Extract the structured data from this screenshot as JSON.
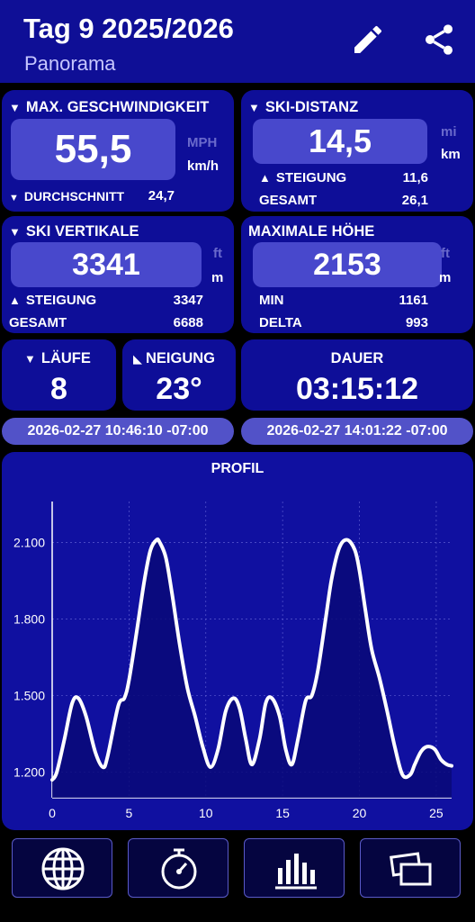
{
  "header": {
    "title": "Tag 9 2025/2026",
    "subtitle": "Panorama",
    "edit_icon": "pencil-icon",
    "share_icon": "share-icon"
  },
  "max_speed": {
    "label": "MAX. GESCHWINDIGKEIT",
    "value": "55,5",
    "unit_alt": "MPH",
    "unit": "km/h",
    "avg_label": "DURCHSCHNITT",
    "avg_value": "24,7"
  },
  "ski_distance": {
    "label": "SKI-DISTANZ",
    "value": "14,5",
    "unit_alt": "mi",
    "unit": "km",
    "climb_label": "STEIGUNG",
    "climb_value": "11,6",
    "total_label": "GESAMT",
    "total_value": "26,1"
  },
  "ski_vertical": {
    "label": "SKI VERTIKALE",
    "value": "3341",
    "unit_alt": "ft",
    "unit": "m",
    "climb_label": "STEIGUNG",
    "climb_value": "3347",
    "total_label": "GESAMT",
    "total_value": "6688"
  },
  "max_altitude": {
    "label": "MAXIMALE HÖHE",
    "value": "2153",
    "unit_alt": "ft",
    "unit": "m",
    "min_label": "MIN",
    "min_value": "1161",
    "delta_label": "DELTA",
    "delta_value": "993"
  },
  "runs": {
    "label": "LÄUFE",
    "value": "8"
  },
  "slope": {
    "label": "NEIGUNG",
    "value": "23°"
  },
  "duration": {
    "label": "DAUER",
    "value": "03:15:12"
  },
  "times": {
    "start": "2026-02-27 10:46:10 -07:00",
    "end": "2026-02-27 14:01:22 -07:00"
  },
  "colors": {
    "card": "#0e0e98",
    "value_box": "#4848cc",
    "pill": "#5252c8",
    "chart_bg": "#1010a0"
  },
  "nav": [
    {
      "icon": "globe-icon"
    },
    {
      "icon": "stopwatch-icon"
    },
    {
      "icon": "bar-chart-icon"
    },
    {
      "icon": "overlapping-windows-icon"
    }
  ],
  "chart_data": {
    "type": "area",
    "title": "PROFIL",
    "xlabel": "",
    "ylabel": "",
    "xlim": [
      0,
      26
    ],
    "ylim": [
      1100,
      2260
    ],
    "x_ticks": [
      0,
      5,
      10,
      15,
      20,
      25
    ],
    "x_tick_labels": [
      "0",
      "5",
      "10",
      "15",
      "20",
      "25"
    ],
    "y_ticks": [
      1200,
      1500,
      1800,
      2100
    ],
    "y_tick_labels": [
      "1.200",
      "1.500",
      "1.800",
      "2.100"
    ],
    "grid": true,
    "series": [
      {
        "x": [
          0,
          0.3,
          0.8,
          1.3,
          1.7,
          2.2,
          2.8,
          3.3,
          3.6,
          4.3,
          4.7,
          5.0,
          5.5,
          6.0,
          6.4,
          6.8,
          7.0,
          7.4,
          7.8,
          8.3,
          8.8,
          9.3,
          9.8,
          10.3,
          10.8,
          11.3,
          11.8,
          12.2,
          12.6,
          13.0,
          13.5,
          13.9,
          14.3,
          14.8,
          15.2,
          15.6,
          16.0,
          16.5,
          16.9,
          17.3,
          17.8,
          18.2,
          18.7,
          19.2,
          19.7,
          20.0,
          20.4,
          20.8,
          21.3,
          21.8,
          22.3,
          22.8,
          23.3,
          23.6,
          24.0,
          24.4,
          24.9,
          25.3,
          25.7,
          26.0
        ],
        "values": [
          1170,
          1200,
          1330,
          1470,
          1490,
          1420,
          1280,
          1220,
          1260,
          1460,
          1490,
          1560,
          1750,
          1950,
          2070,
          2110,
          2100,
          2040,
          1900,
          1700,
          1530,
          1420,
          1300,
          1220,
          1290,
          1440,
          1490,
          1450,
          1330,
          1230,
          1330,
          1470,
          1490,
          1420,
          1290,
          1230,
          1330,
          1480,
          1500,
          1600,
          1800,
          1960,
          2080,
          2110,
          2070,
          1990,
          1830,
          1680,
          1570,
          1440,
          1300,
          1190,
          1190,
          1230,
          1280,
          1300,
          1290,
          1250,
          1230,
          1225
        ]
      }
    ]
  }
}
